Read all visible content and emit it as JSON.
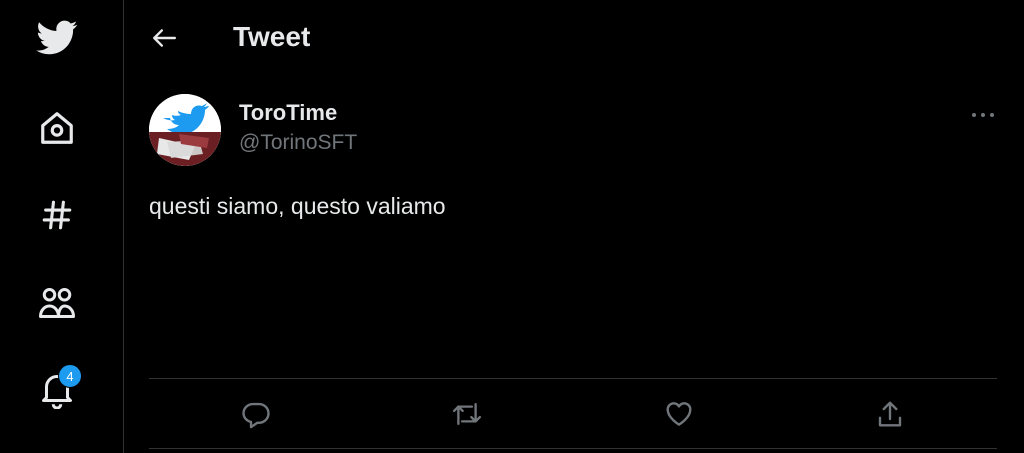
{
  "header": {
    "title": "Tweet"
  },
  "sidebar": {
    "items": [
      {
        "name": "twitter-logo-icon"
      },
      {
        "name": "home-icon"
      },
      {
        "name": "explore-hashtag-icon"
      },
      {
        "name": "communities-icon"
      },
      {
        "name": "notifications-bell-icon"
      }
    ],
    "notification_count": "4"
  },
  "tweet": {
    "display_name": "ToroTime",
    "handle": "@TorinoSFT",
    "text": "questi siamo, questo valiamo"
  },
  "actions": [
    "reply-icon",
    "retweet-icon",
    "like-icon",
    "share-icon"
  ],
  "colors": {
    "accent": "#1d9bf0",
    "background": "#000000",
    "text": "#e7e9ea",
    "muted": "#71767b",
    "border": "#2f3336"
  }
}
